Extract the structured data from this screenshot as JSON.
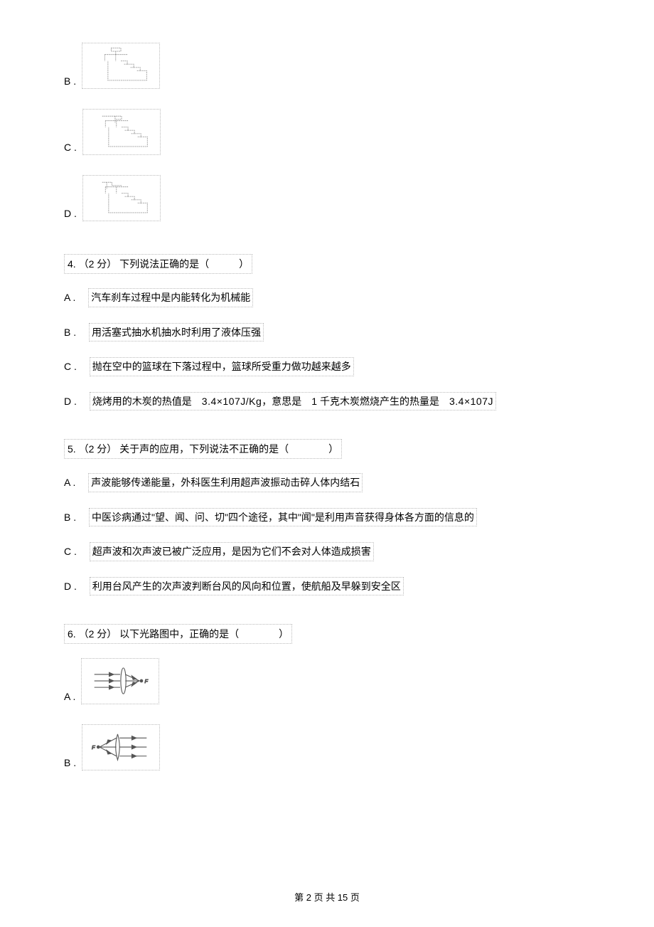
{
  "opt3": {
    "B": "B .",
    "C": "C .",
    "D": "D ."
  },
  "q4": {
    "num": "4.",
    "points": "（2 分）",
    "text": "下列说法正确的是（　　　）",
    "A_label": "A .",
    "A_text": "汽车刹车过程中是内能转化为机械能",
    "B_label": "B .",
    "B_text": "用活塞式抽水机抽水时利用了液体压强",
    "C_label": "C .",
    "C_text": "抛在空中的篮球在下落过程中，篮球所受重力做功越来越多",
    "D_label": "D .",
    "D_text_pre": "烧烤用的木炭的热值是　",
    "D_val1": "3.4×107J/Kg",
    "D_text_mid": "，意思是　1 千克木炭燃烧产生的热量是　",
    "D_val2": "3.4×107J"
  },
  "q5": {
    "num": "5.",
    "points": "（2 分）",
    "text": "关于声的应用，下列说法不正确的是（　　　　）",
    "A_label": "A .",
    "A_text": "声波能够传递能量，外科医生利用超声波振动击碎人体内结石",
    "B_label": "B .",
    "B_text": "中医诊病通过\"望、闻、问、切\"四个途径，其中\"闻\"是利用声音获得身体各方面的信息的",
    "C_label": "C .",
    "C_text": "超声波和次声波已被广泛应用，是因为它们不会对人体造成损害",
    "D_label": "D .",
    "D_text": "利用台风产生的次声波判断台风的风向和位置，使航船及早躲到安全区"
  },
  "q6": {
    "num": "6.",
    "points": "（2 分）",
    "text": "以下光路图中，正确的是（　　　　）",
    "A_label": "A .",
    "B_label": "B ."
  },
  "footer": "第 2 页 共 15 页"
}
